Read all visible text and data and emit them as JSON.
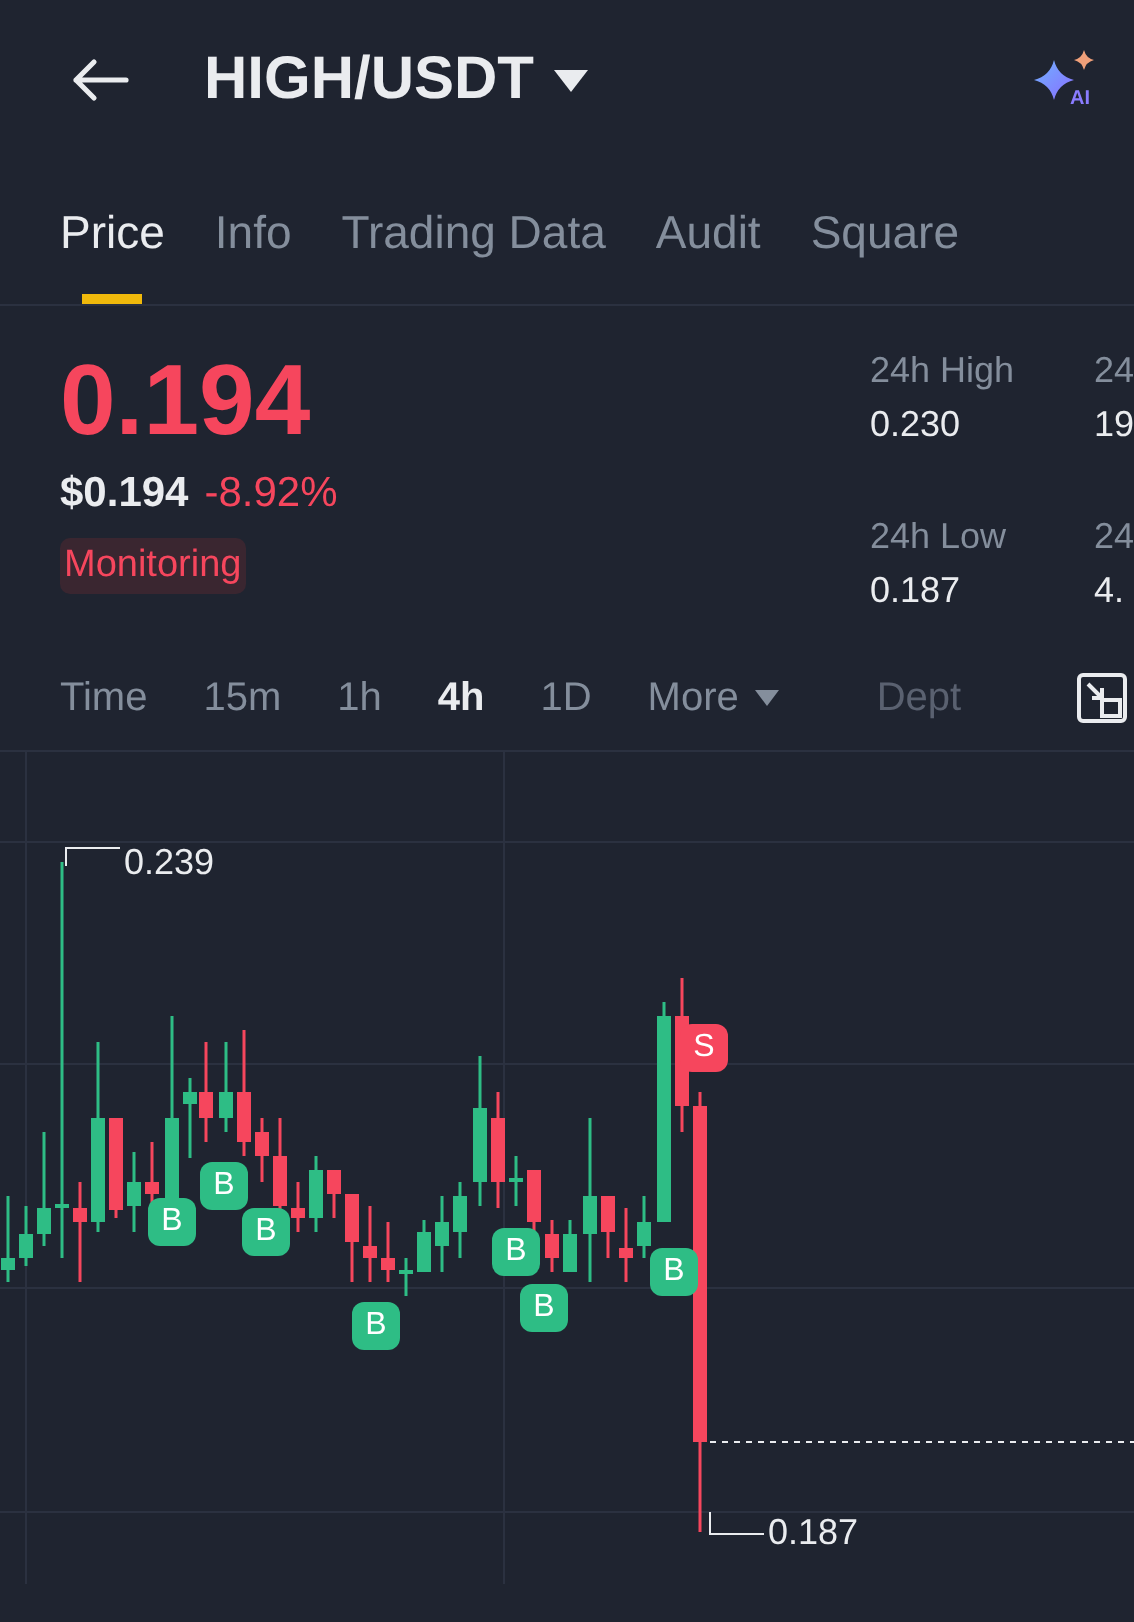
{
  "header": {
    "title": "HIGH/USDT",
    "ai_badge": "AI"
  },
  "tabs": [
    {
      "label": "Price",
      "selected": true
    },
    {
      "label": "Info",
      "selected": false
    },
    {
      "label": "Trading Data",
      "selected": false
    },
    {
      "label": "Audit",
      "selected": false
    },
    {
      "label": "Square",
      "selected": false
    }
  ],
  "price": {
    "last": "0.194",
    "usd": "$0.194",
    "change": "-8.92%",
    "tag": "Monitoring"
  },
  "stats": [
    {
      "label": "24h High",
      "value": "0.230"
    },
    {
      "label": "24",
      "value": "19"
    },
    {
      "label": "24h Low",
      "value": "0.187"
    },
    {
      "label": "24",
      "value": "4."
    }
  ],
  "intervals": [
    {
      "label": "Time",
      "selected": false,
      "kind": "plain"
    },
    {
      "label": "15m",
      "selected": false,
      "kind": "plain"
    },
    {
      "label": "1h",
      "selected": false,
      "kind": "plain"
    },
    {
      "label": "4h",
      "selected": true,
      "kind": "plain"
    },
    {
      "label": "1D",
      "selected": false,
      "kind": "plain"
    },
    {
      "label": "More",
      "selected": false,
      "kind": "dropdown"
    },
    {
      "label": "Dept",
      "selected": false,
      "kind": "faded"
    }
  ],
  "chart": {
    "high_label": "0.239",
    "low_label": "0.187",
    "markers": [
      {
        "kind": "buy",
        "label": "B"
      },
      {
        "kind": "buy",
        "label": "B"
      },
      {
        "kind": "buy",
        "label": "B"
      },
      {
        "kind": "buy",
        "label": "B"
      },
      {
        "kind": "buy",
        "label": "B"
      },
      {
        "kind": "buy",
        "label": "B"
      },
      {
        "kind": "buy",
        "label": "B"
      },
      {
        "kind": "sell",
        "label": "S"
      }
    ]
  }
}
